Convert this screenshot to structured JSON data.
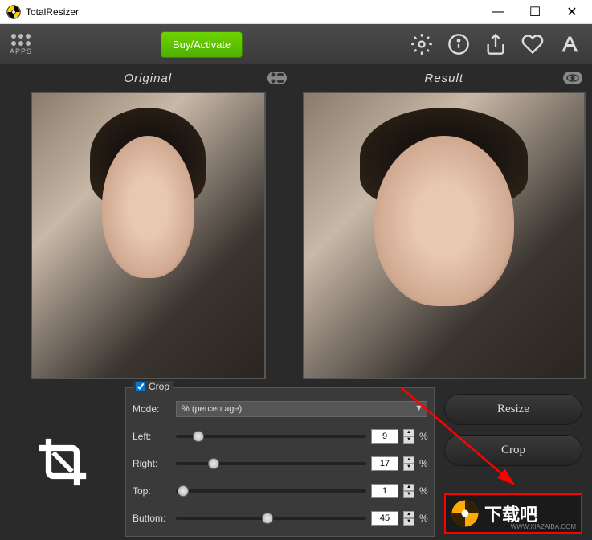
{
  "window": {
    "title": "TotalResizer",
    "min": "—",
    "max": "☐",
    "close": "✕"
  },
  "toolbar": {
    "apps_label": "APPS",
    "buy_label": "Buy/Activate"
  },
  "panels": {
    "original_label": "Original",
    "result_label": "Result"
  },
  "crop": {
    "legend": "Crop",
    "checked": true,
    "mode_label": "Mode:",
    "mode_value": "% (percentage)",
    "sliders": [
      {
        "label": "Left:",
        "value": "9",
        "percent": 9
      },
      {
        "label": "Right:",
        "value": "17",
        "percent": 17
      },
      {
        "label": "Top:",
        "value": "1",
        "percent": 1
      },
      {
        "label": "Buttom:",
        "value": "45",
        "percent": 45
      }
    ],
    "pct_symbol": "%"
  },
  "actions": {
    "resize_label": "Resize",
    "crop_label": "Crop"
  },
  "watermark": {
    "text": "下载吧",
    "sub": "WWW.XIAZAIBA.COM"
  }
}
